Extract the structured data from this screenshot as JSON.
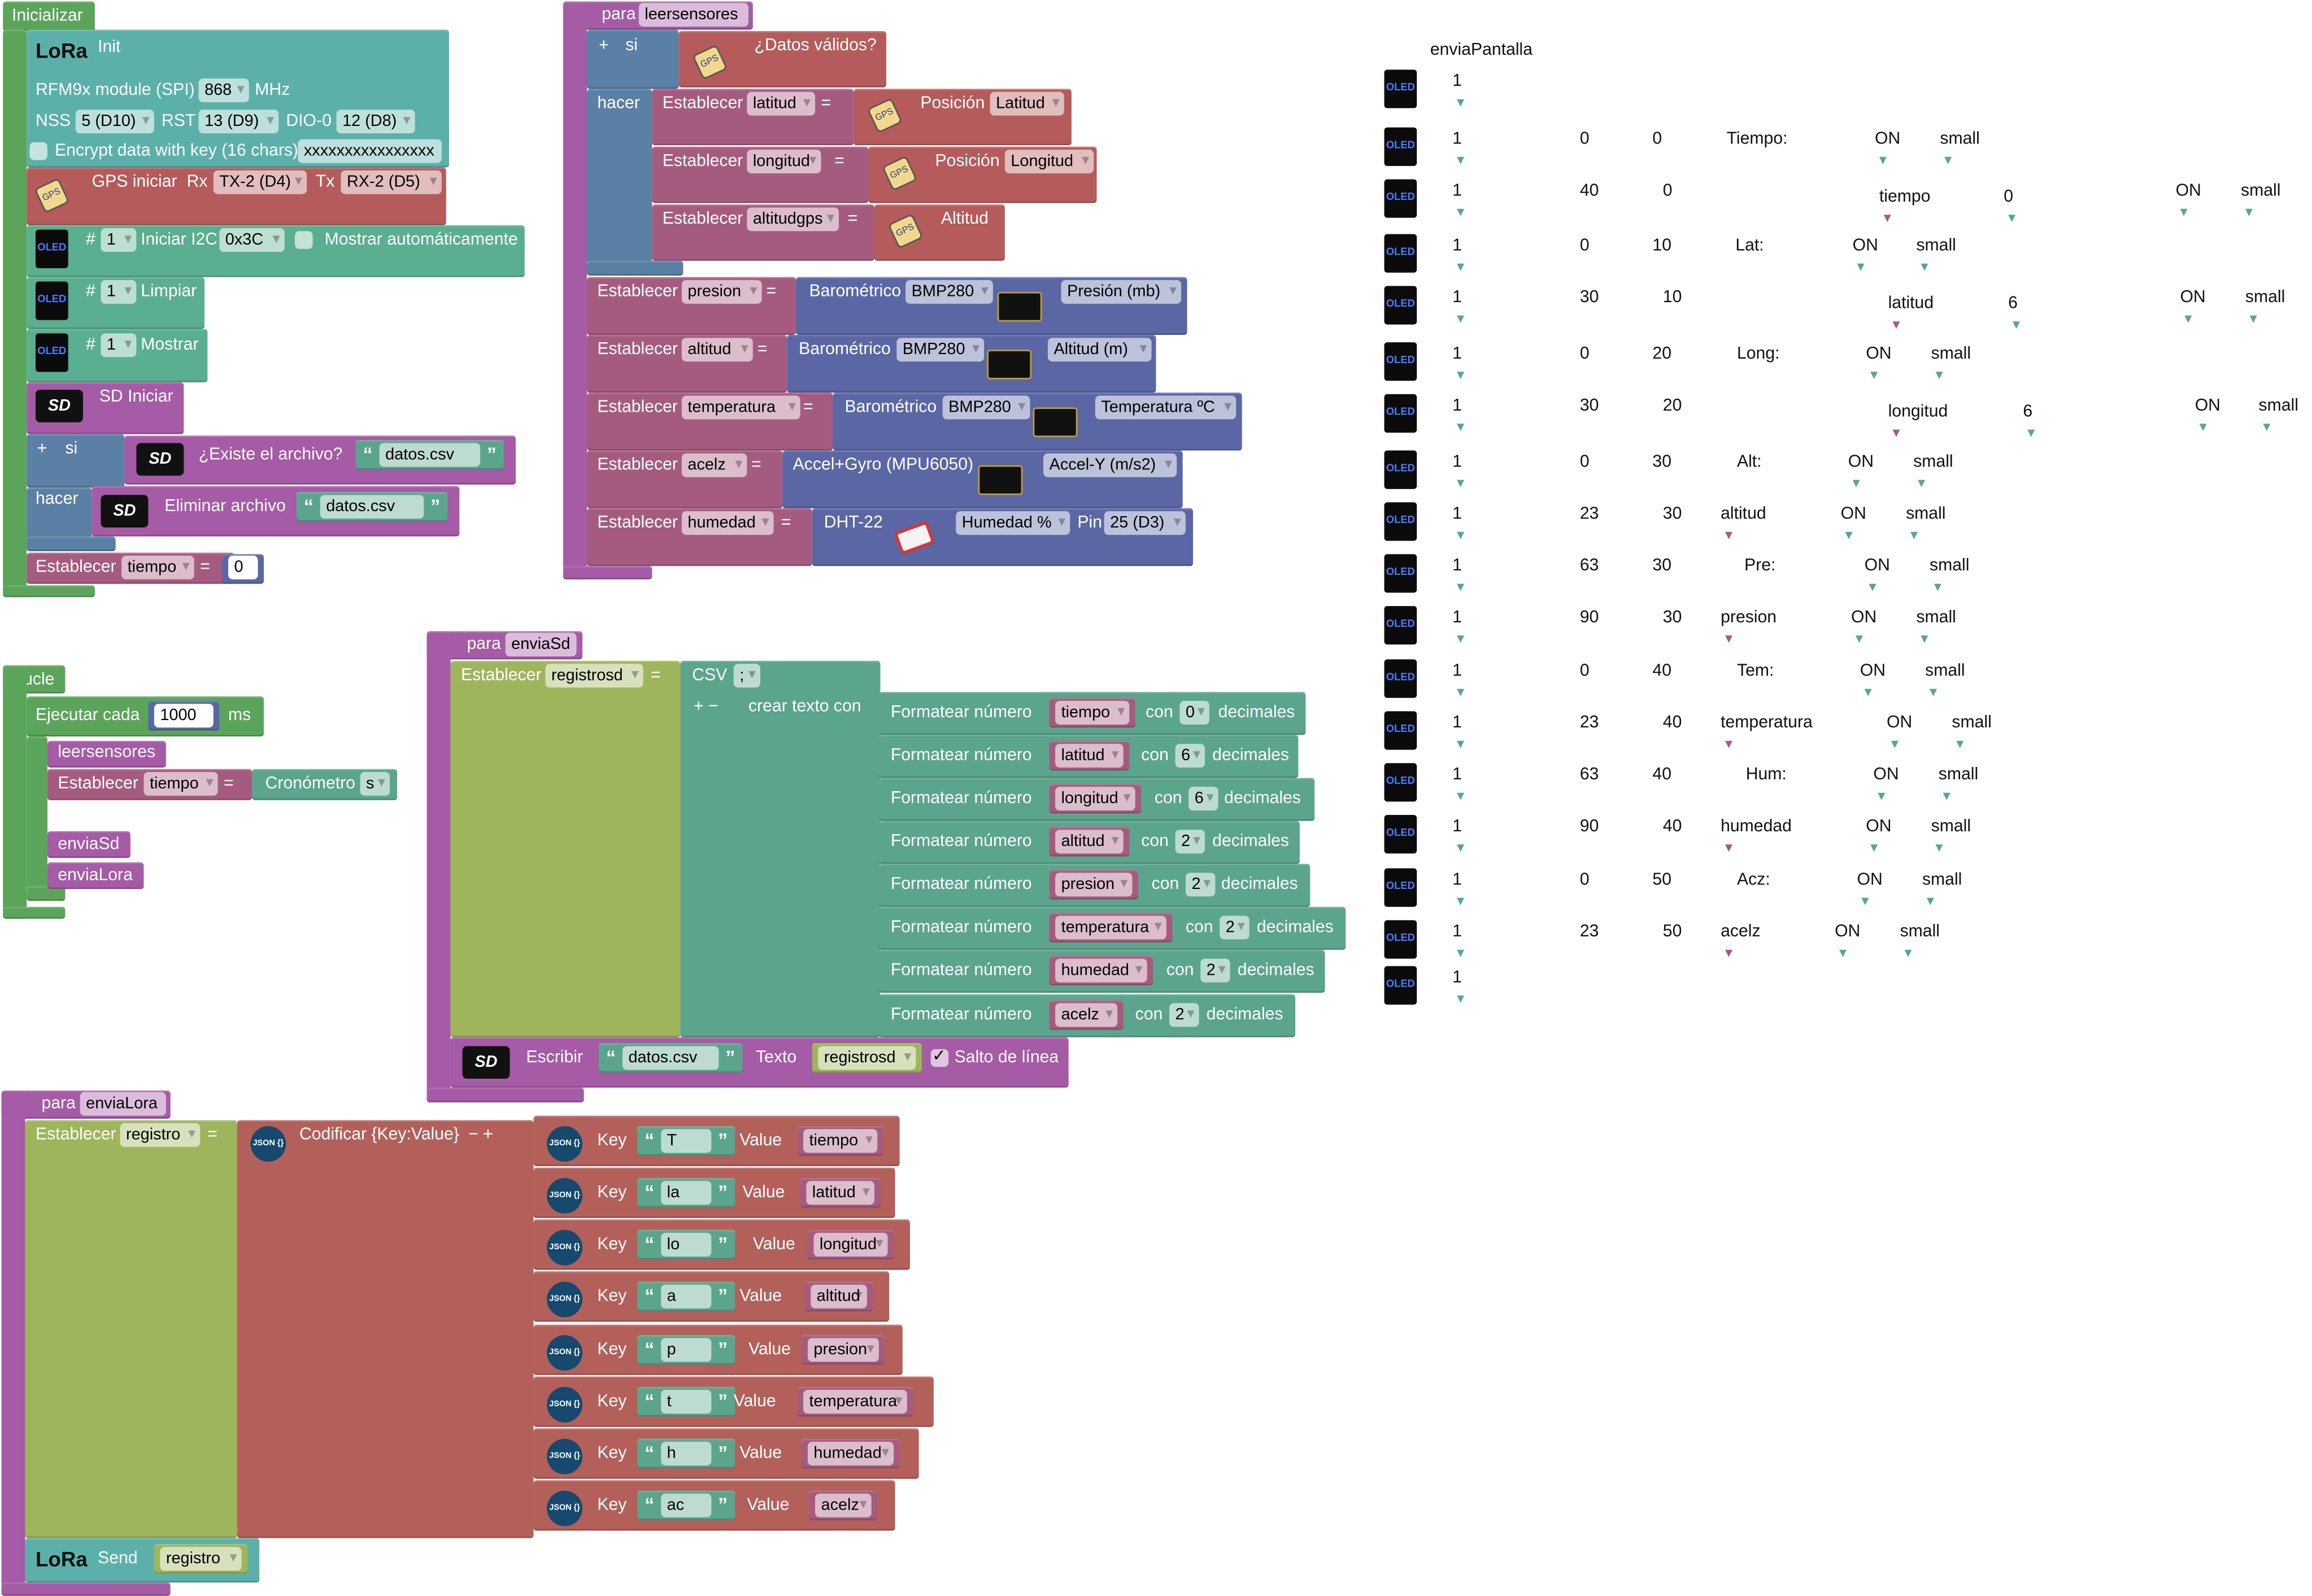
{
  "colors": {
    "event": "#5ba55b",
    "lora": "#5bb1aa",
    "gps": "#b55b5b",
    "oled": "#5aaf90",
    "procedure": "#a55ba5",
    "variable": "#a55b80",
    "logic": "#5b80a5",
    "sensor": "#5b67a5",
    "text": "#5ba58c",
    "olive": "#9fb55b",
    "json": "#b4605a"
  },
  "icons": {
    "lora": "LoRa",
    "oled": "OLED",
    "sd": "SD",
    "gps": "GPS",
    "json": "JSON {}"
  },
  "common": {
    "set": "Establecer",
    "eq": "="
  },
  "init": {
    "hat": "Inicializar",
    "lora": {
      "title": "Init",
      "module": "RFM9x module (SPI)",
      "freq": "868",
      "mhz": "MHz",
      "nss_label": "NSS",
      "nss": "5 (D10)",
      "rst_label": "RST",
      "rst": "13 (D9)",
      "dio_label": "DIO-0",
      "dio": "12 (D8)",
      "encrypt_label": "Encrypt data with key (16 chars)",
      "key": "xxxxxxxxxxxxxxxx",
      "encrypt_checked": false
    },
    "gps": {
      "label": "GPS iniciar",
      "rx_label": "Rx",
      "rx": "TX-2 (D4)",
      "tx_label": "Tx",
      "tx": "RX-2 (D5)"
    },
    "oled_init": {
      "hash": "#",
      "num": "1",
      "label": "Iniciar I2C",
      "addr": "0x3C",
      "auto_label": "Mostrar automáticamente",
      "auto_checked": false
    },
    "oled_clear": {
      "hash": "#",
      "num": "1",
      "label": "Limpiar"
    },
    "oled_show": {
      "hash": "#",
      "num": "1",
      "label": "Mostrar"
    },
    "sd_init": "SD Iniciar",
    "if": {
      "plus": "+",
      "si": "si",
      "exists": "¿Existe el archivo?",
      "file": "datos.csv",
      "hacer": "hacer",
      "delete": "Eliminar archivo",
      "delete_file": "datos.csv"
    },
    "set": {
      "var": "tiempo",
      "value": "0"
    }
  },
  "loop": {
    "hat": "Bucle",
    "every_label": "Ejecutar cada",
    "interval": "1000",
    "unit": "ms",
    "calls": [
      "leersensores",
      "enviaSd",
      "enviaLora"
    ],
    "set": {
      "var": "tiempo",
      "timer": "Cronómetro",
      "timer_unit": "s"
    }
  },
  "leer": {
    "plus": "+",
    "para": "para",
    "name": "leersensores",
    "si": "si",
    "cond": "¿Datos válidos?",
    "hacer": "hacer",
    "sets": [
      {
        "var": "latitud",
        "src": "Posición",
        "field": "Latitud"
      },
      {
        "var": "longitud",
        "src": "Posición",
        "field": "Longitud"
      },
      {
        "var": "altitudgps",
        "src": "Altitud"
      }
    ],
    "sensors": [
      {
        "var": "presion",
        "src": "Barométrico",
        "model": "BMP280",
        "measure": "Presión (mb)"
      },
      {
        "var": "altitud",
        "src": "Barométrico",
        "model": "BMP280",
        "measure": "Altitud (m)"
      },
      {
        "var": "temperatura",
        "src": "Barométrico",
        "model": "BMP280",
        "measure": "Temperatura ºC"
      },
      {
        "var": "acelz",
        "src": "Accel+Gyro (MPU6050)",
        "measure": "Accel-Y (m/s2)"
      },
      {
        "var": "humedad",
        "src": "DHT-22",
        "measure": "Humedad %",
        "pin_label": "Pin",
        "pin": "25 (D3)"
      }
    ]
  },
  "sd_proc": {
    "plus": "+",
    "para": "para",
    "name": "enviaSd",
    "var": "registrosd",
    "csv": "CSV",
    "sep": ";",
    "mutator": "+  −",
    "create_text": "crear texto con",
    "format_label": "Formatear número",
    "con": "con",
    "decimales": "decimales",
    "rows": [
      {
        "var": "tiempo",
        "decimals": "0"
      },
      {
        "var": "latitud",
        "decimals": "6"
      },
      {
        "var": "longitud",
        "decimals": "6"
      },
      {
        "var": "altitud",
        "decimals": "2"
      },
      {
        "var": "presion",
        "decimals": "2"
      },
      {
        "var": "temperatura",
        "decimals": "2"
      },
      {
        "var": "humedad",
        "decimals": "2"
      },
      {
        "var": "acelz",
        "decimals": "2"
      }
    ],
    "write": "Escribir",
    "file": "datos.csv",
    "text_label": "Texto",
    "newline": "Salto de línea",
    "newline_checked": true
  },
  "lora_proc": {
    "plus": "+",
    "para": "para",
    "name": "enviaLora",
    "var": "registro",
    "encode": "Codificar {Key:Value}",
    "mutator": "−  +",
    "key_label": "Key",
    "value_label": "Value",
    "pairs": [
      {
        "key": "T",
        "value": "tiempo"
      },
      {
        "key": "la",
        "value": "latitud"
      },
      {
        "key": "lo",
        "value": "longitud"
      },
      {
        "key": "a",
        "value": "altitud"
      },
      {
        "key": "p",
        "value": "presion"
      },
      {
        "key": "t",
        "value": "temperatura"
      },
      {
        "key": "h",
        "value": "humedad"
      },
      {
        "key": "ac",
        "value": "acelz"
      }
    ],
    "send": "Send"
  },
  "pantalla": {
    "title": "enviaPantalla",
    "rows": [
      {
        "display": "1"
      },
      {
        "display": "1",
        "x": "0",
        "y": "0",
        "text": "Tiempo:",
        "mode": "ON",
        "size": "small"
      },
      {
        "display": "1",
        "x": "40",
        "y": "0",
        "var": "tiempo",
        "digits": "0",
        "mode": "ON",
        "size": "small"
      },
      {
        "display": "1",
        "x": "0",
        "y": "10",
        "text": "Lat:",
        "mode": "ON",
        "size": "small"
      },
      {
        "display": "1",
        "x": "30",
        "y": "10",
        "var": "latitud",
        "digits": "6",
        "mode": "ON",
        "size": "small"
      },
      {
        "display": "1",
        "x": "0",
        "y": "20",
        "text": "Long:",
        "mode": "ON",
        "size": "small"
      },
      {
        "display": "1",
        "x": "30",
        "y": "20",
        "var": "longitud",
        "digits": "6",
        "mode": "ON",
        "size": "small"
      },
      {
        "display": "1",
        "x": "0",
        "y": "30",
        "text": "Alt:",
        "mode": "ON",
        "size": "small"
      },
      {
        "display": "1",
        "x": "23",
        "y": "30",
        "var": "altitud",
        "mode": "ON",
        "size": "small"
      },
      {
        "display": "1",
        "x": "63",
        "y": "30",
        "text": "Pre:",
        "mode": "ON",
        "size": "small"
      },
      {
        "display": "1",
        "x": "90",
        "y": "30",
        "var": "presion",
        "mode": "ON",
        "size": "small"
      },
      {
        "display": "1",
        "x": "0",
        "y": "40",
        "text": "Tem:",
        "mode": "ON",
        "size": "small"
      },
      {
        "display": "1",
        "x": "23",
        "y": "40",
        "var": "temperatura",
        "mode": "ON",
        "size": "small"
      },
      {
        "display": "1",
        "x": "63",
        "y": "40",
        "text": "Hum:",
        "mode": "ON",
        "size": "small"
      },
      {
        "display": "1",
        "x": "90",
        "y": "40",
        "var": "humedad",
        "mode": "ON",
        "size": "small"
      },
      {
        "display": "1",
        "x": "0",
        "y": "50",
        "text": "Acz:",
        "mode": "ON",
        "size": "small"
      },
      {
        "display": "1",
        "x": "23",
        "y": "50",
        "var": "acelz",
        "mode": "ON",
        "size": "small"
      },
      {
        "display": "1"
      }
    ]
  }
}
